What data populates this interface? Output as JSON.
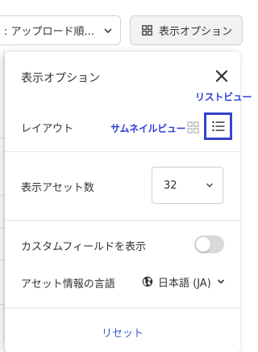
{
  "toolbar": {
    "sort_label": ": アップロード順...",
    "display_options_label": "表示オプション"
  },
  "panel": {
    "title": "表示オプション",
    "annotations": {
      "list_view": "リストビュー",
      "thumbnail_view": "サムネイルビュー"
    },
    "layout": {
      "label": "レイアウト",
      "options": [
        "thumbnail",
        "list"
      ],
      "selected": "list"
    },
    "asset_count": {
      "label": "表示アセット数",
      "value": "32"
    },
    "custom_fields": {
      "label": "カスタムフィールドを表示",
      "enabled": false
    },
    "asset_language": {
      "label": "アセット情報の言語",
      "value": "日本語 (JA)"
    },
    "reset_label": "リセット"
  },
  "colors": {
    "annotation": "#2f3fd6",
    "highlight_border": "#3344cc",
    "link": "#3b5ac6",
    "toggle_off": "#d9d9d9"
  },
  "icons": [
    "chevron-down-icon",
    "grid-icon",
    "close-icon",
    "list-icon",
    "globe-icon"
  ]
}
